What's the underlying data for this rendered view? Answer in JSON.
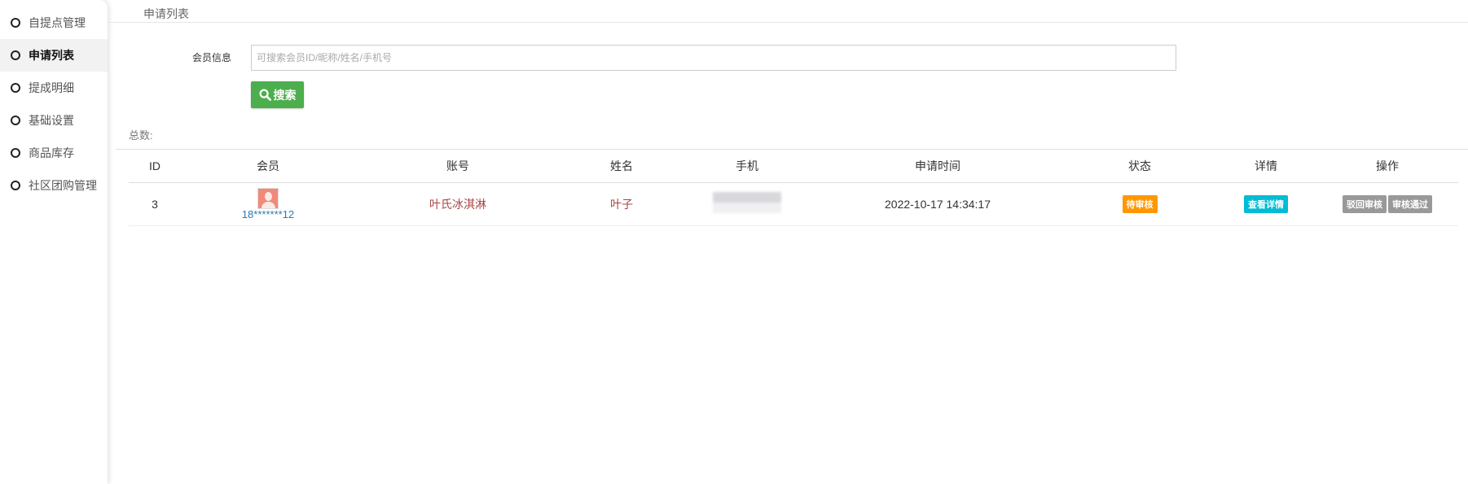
{
  "sidebar": {
    "items": [
      {
        "label": "自提点管理"
      },
      {
        "label": "申请列表",
        "active": true
      },
      {
        "label": "提成明细"
      },
      {
        "label": "基础设置"
      },
      {
        "label": "商品库存"
      },
      {
        "label": "社区团购管理"
      }
    ]
  },
  "header": {
    "title": "申请列表"
  },
  "filter": {
    "label": "会员信息",
    "placeholder": "可搜索会员ID/昵称/姓名/手机号",
    "value": "",
    "search_label": "搜索"
  },
  "total_label": "总数:",
  "table": {
    "columns": [
      "ID",
      "会员",
      "账号",
      "姓名",
      "手机",
      "申请时间",
      "状态",
      "详情",
      "操作"
    ],
    "rows": [
      {
        "id": "3",
        "member": "18*******12",
        "account": "叶氏冰淇淋",
        "name": "叶子",
        "time": "2022-10-17 14:34:17",
        "status": "待审核",
        "detail": "查看详情",
        "actions": [
          "驳回审核",
          "审核通过"
        ]
      }
    ]
  },
  "colors": {
    "search": "#4cae4c",
    "pending": "#ff9800",
    "detail": "#00bcd4",
    "action": "#999999"
  }
}
